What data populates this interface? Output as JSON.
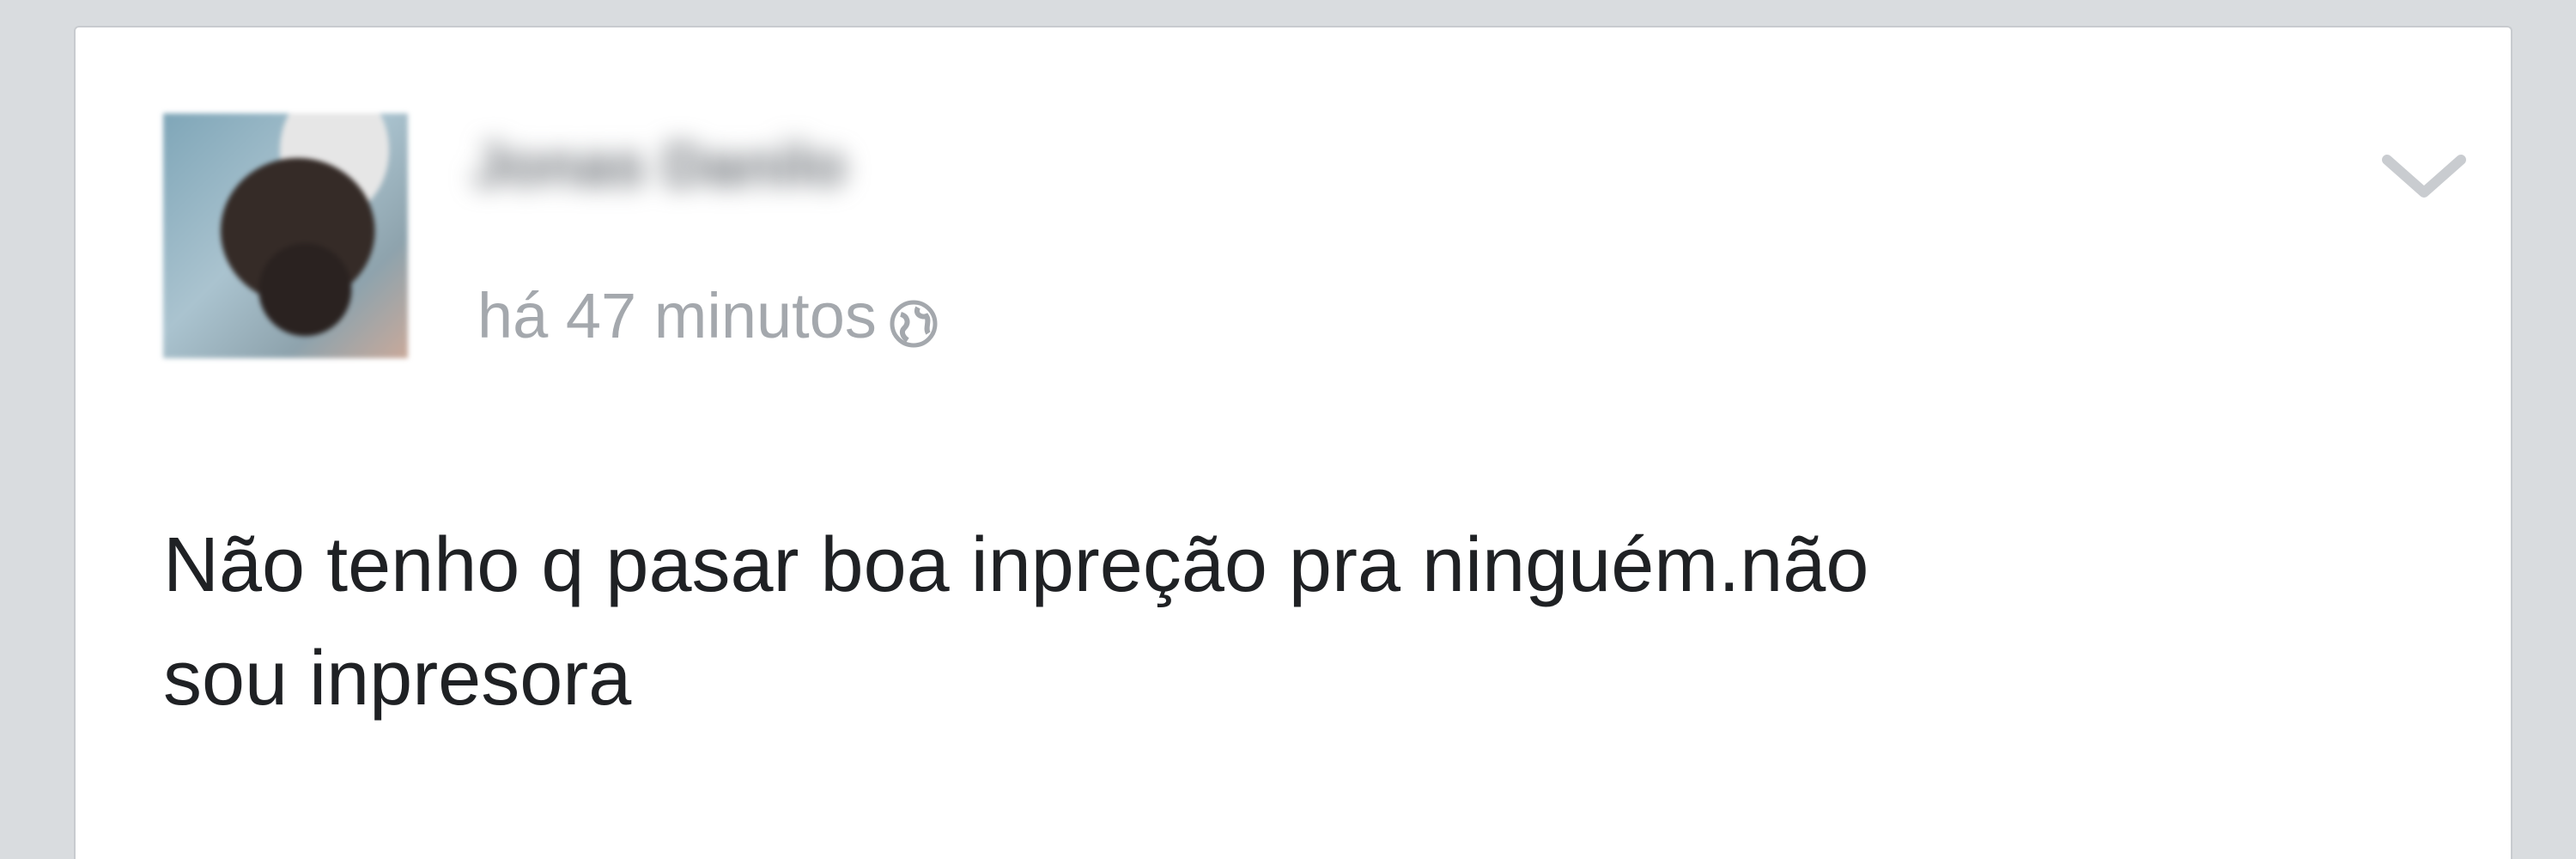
{
  "post": {
    "author": "Jonas Danilo",
    "timestamp": "há 47 minutos",
    "privacy_icon": "globe-icon",
    "menu_icon": "chevron-down-icon",
    "text_line1": "Não tenho q pasar boa inpreção pra ninguém.não",
    "text_line2": "sou inpresora"
  },
  "colors": {
    "background": "#d9dcdf",
    "card": "#ffffff",
    "timestamp": "#a4a8ad",
    "text": "#1f2124"
  }
}
